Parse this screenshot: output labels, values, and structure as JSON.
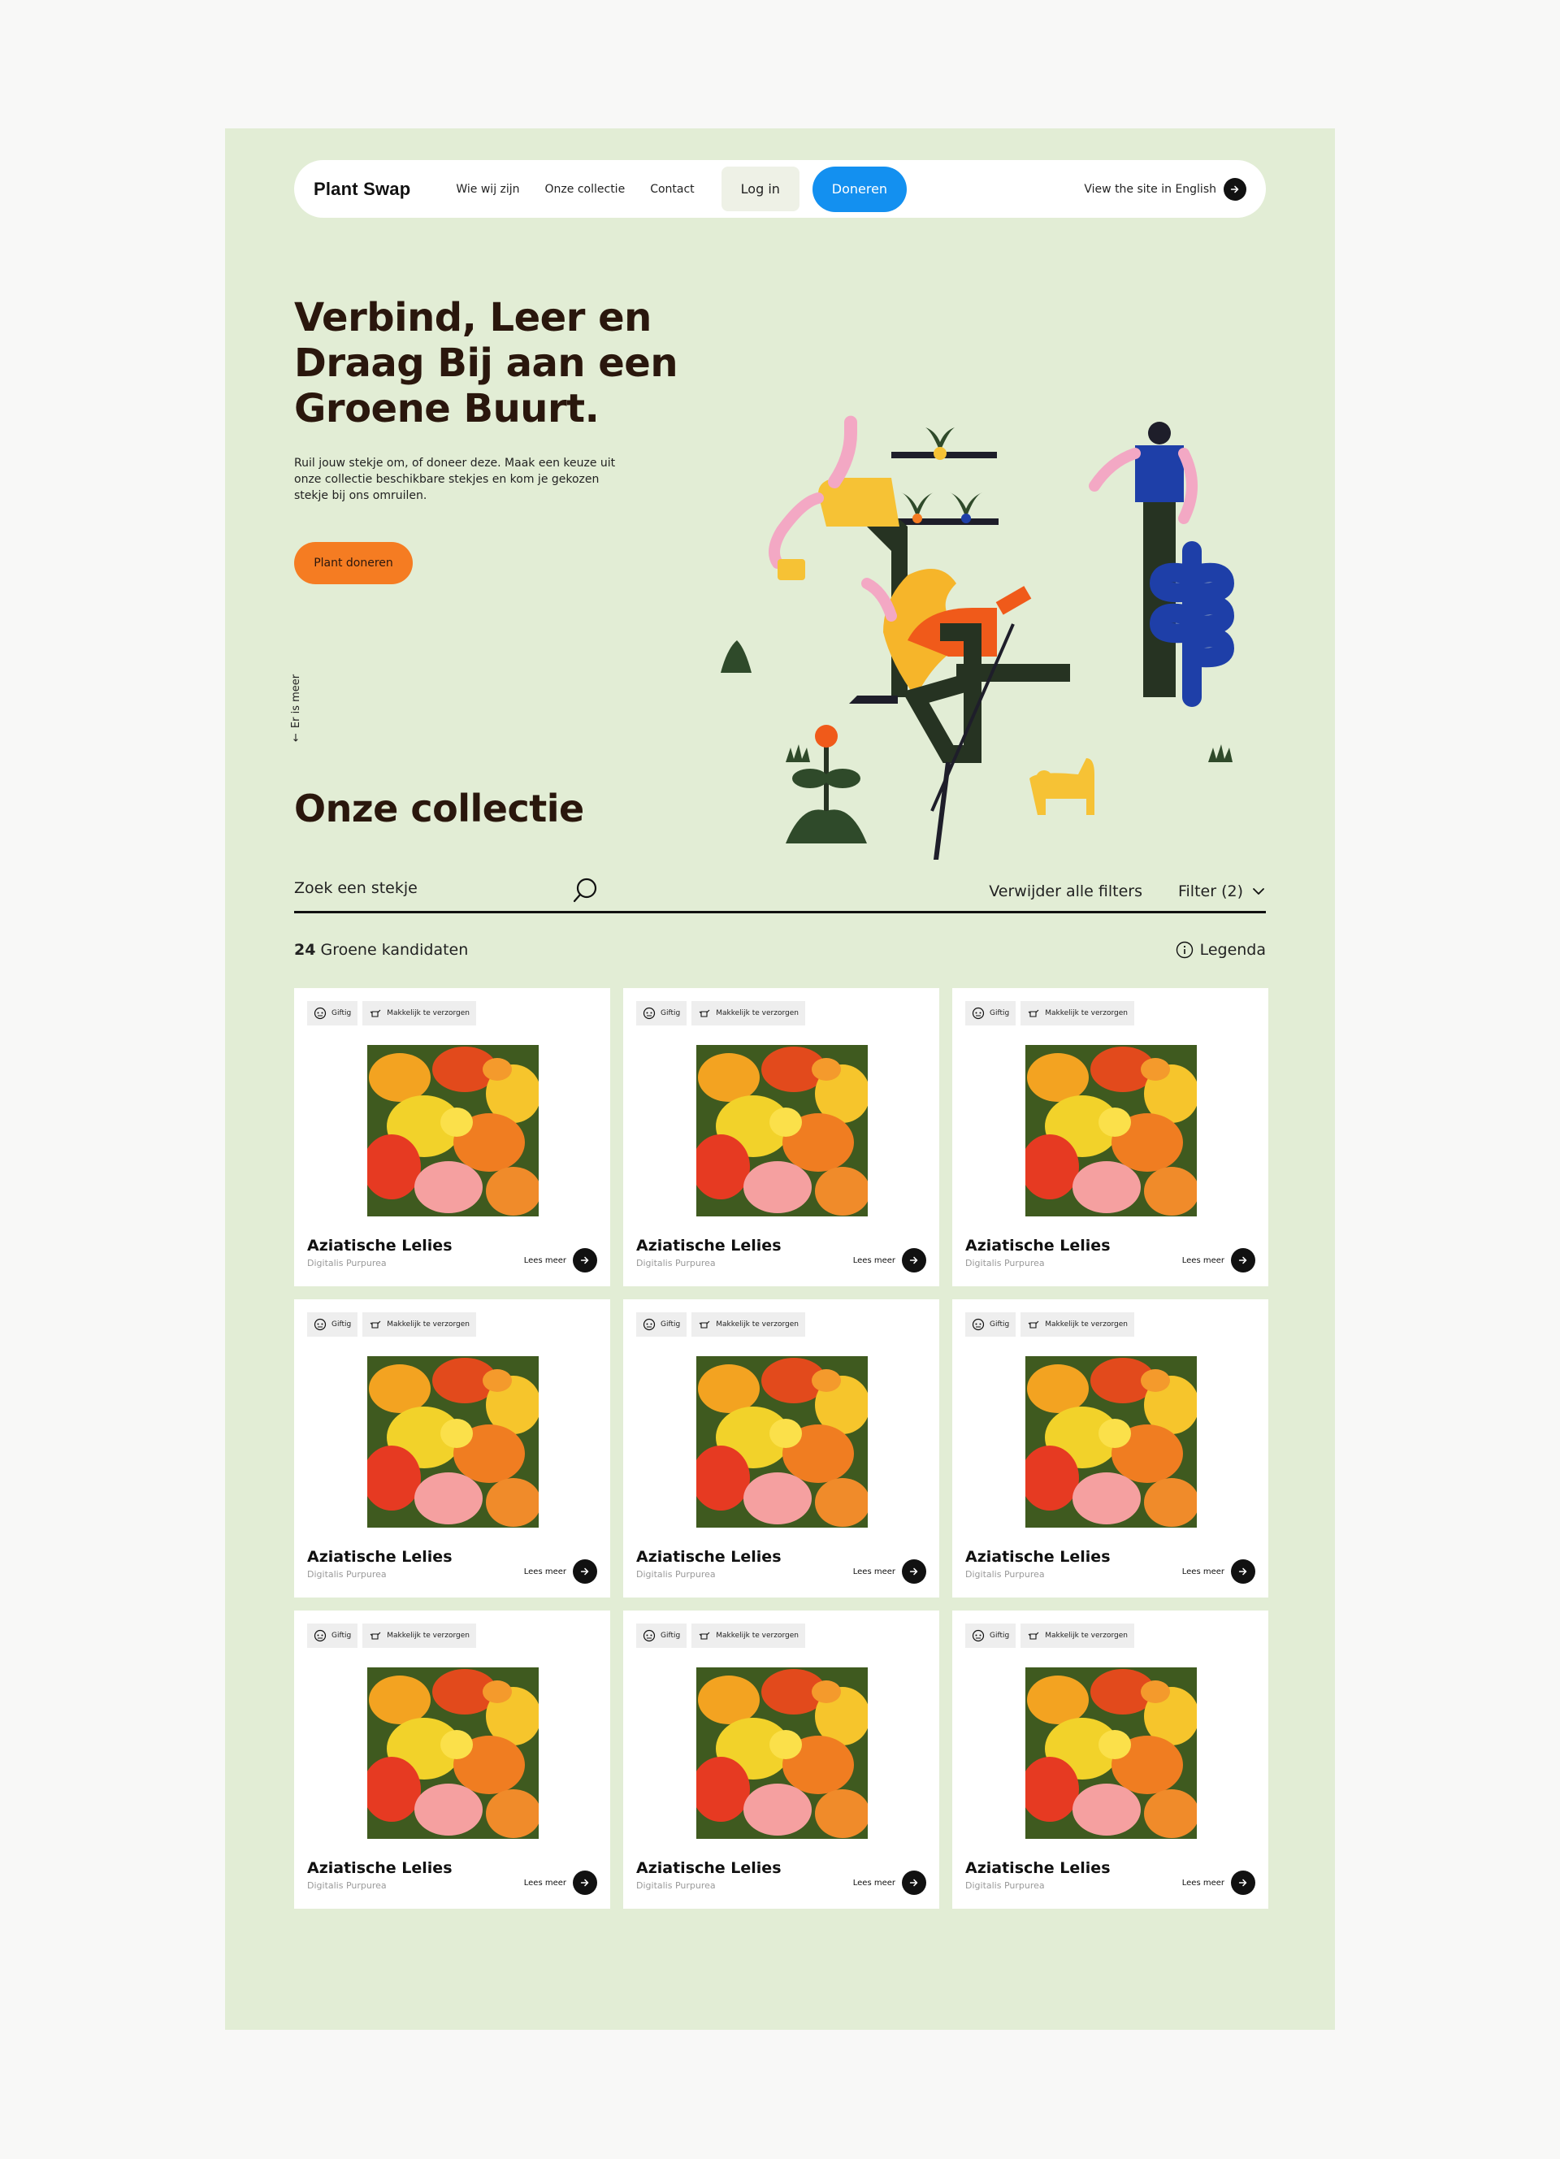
{
  "nav": {
    "logo": "Plant Swap",
    "links": [
      "Wie wij zijn",
      "Onze collectie",
      "Contact"
    ],
    "login": "Log in",
    "donate": "Doneren",
    "lang": "View the site in English"
  },
  "hero": {
    "title": "Verbind, Leer en Draag Bij aan een Groene Buurt.",
    "text": "Ruil jouw stekje om, of doneer deze. Maak een keuze uit onze collectie beschikbare stekjes en kom je gekozen stekje bij ons omruilen.",
    "cta": "Plant doneren",
    "scroll": "Er is meer"
  },
  "collection": {
    "title": "Onze collectie",
    "search_placeholder": "Zoek een stekje",
    "clear_filters": "Verwijder alle filters",
    "filter": "Filter (2)",
    "count_number": "24",
    "count_label": "Groene kandidaten",
    "legend": "Legenda",
    "cards": [
      {
        "tag1": "Giftig",
        "tag2": "Makkelijk te verzorgen",
        "title": "Aziatische Lelies",
        "subtitle": "Digitalis Purpurea",
        "more": "Lees meer"
      },
      {
        "tag1": "Giftig",
        "tag2": "Makkelijk te verzorgen",
        "title": "Aziatische Lelies",
        "subtitle": "Digitalis Purpurea",
        "more": "Lees meer"
      },
      {
        "tag1": "Giftig",
        "tag2": "Makkelijk te verzorgen",
        "title": "Aziatische Lelies",
        "subtitle": "Digitalis Purpurea",
        "more": "Lees meer"
      },
      {
        "tag1": "Giftig",
        "tag2": "Makkelijk te verzorgen",
        "title": "Aziatische Lelies",
        "subtitle": "Digitalis Purpurea",
        "more": "Lees meer"
      },
      {
        "tag1": "Giftig",
        "tag2": "Makkelijk te verzorgen",
        "title": "Aziatische Lelies",
        "subtitle": "Digitalis Purpurea",
        "more": "Lees meer"
      },
      {
        "tag1": "Giftig",
        "tag2": "Makkelijk te verzorgen",
        "title": "Aziatische Lelies",
        "subtitle": "Digitalis Purpurea",
        "more": "Lees meer"
      },
      {
        "tag1": "Giftig",
        "tag2": "Makkelijk te verzorgen",
        "title": "Aziatische Lelies",
        "subtitle": "Digitalis Purpurea",
        "more": "Lees meer"
      },
      {
        "tag1": "Giftig",
        "tag2": "Makkelijk te verzorgen",
        "title": "Aziatische Lelies",
        "subtitle": "Digitalis Purpurea",
        "more": "Lees meer"
      },
      {
        "tag1": "Giftig",
        "tag2": "Makkelijk te verzorgen",
        "title": "Aziatische Lelies",
        "subtitle": "Digitalis Purpurea",
        "more": "Lees meer"
      }
    ]
  },
  "colors": {
    "page_bg": "#e2edd5",
    "accent_blue": "#1390f0",
    "accent_orange": "#f57c22",
    "heading": "#2a170d"
  }
}
